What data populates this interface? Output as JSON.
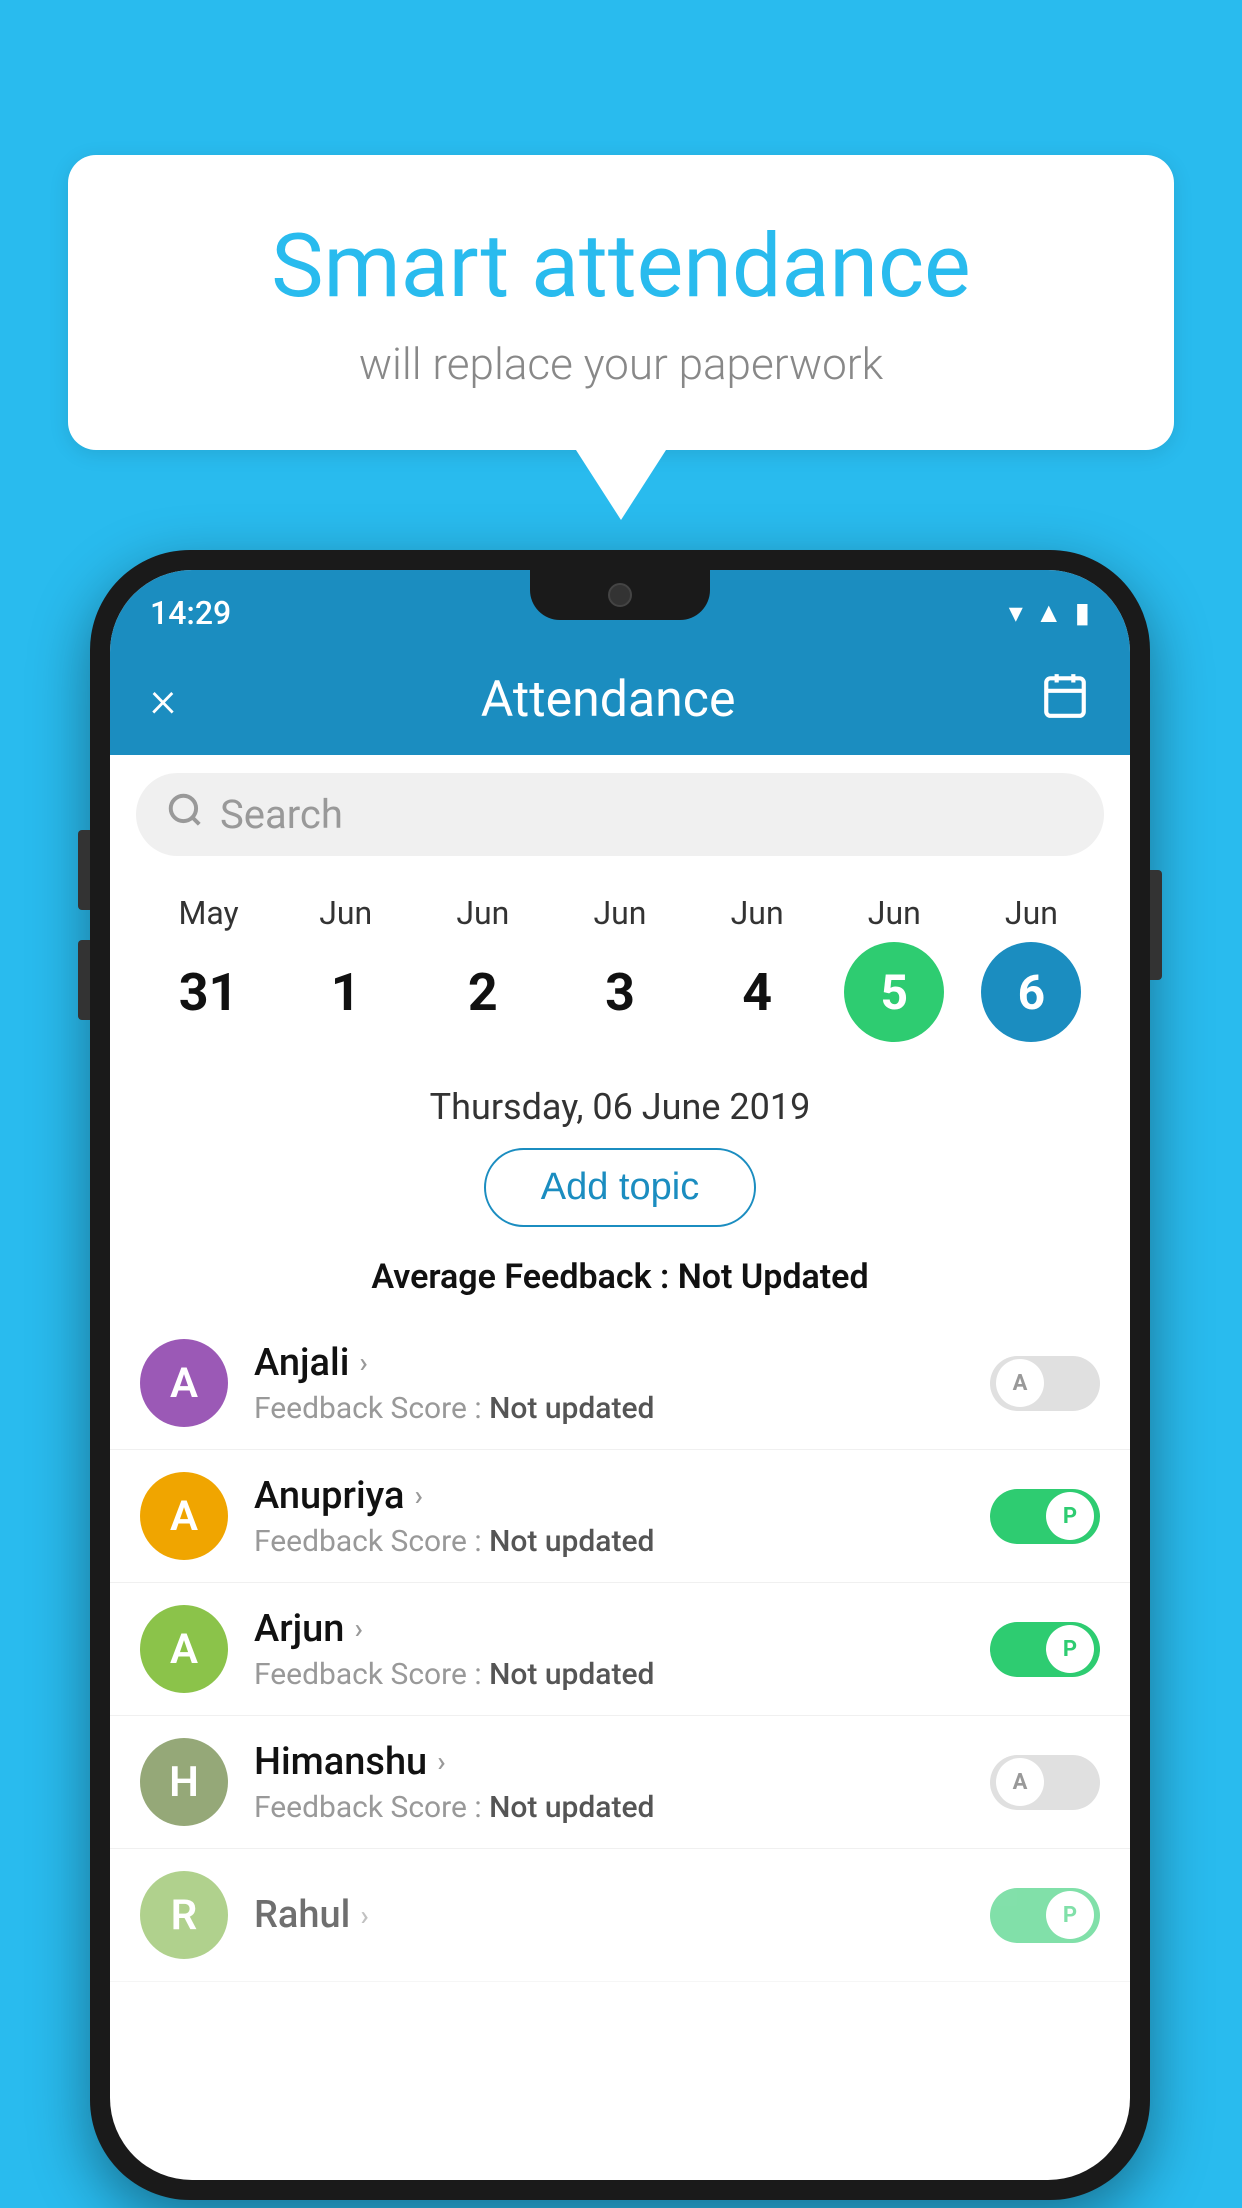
{
  "background_color": "#29BBEE",
  "speech_bubble": {
    "title": "Smart attendance",
    "subtitle": "will replace your paperwork"
  },
  "status_bar": {
    "time": "14:29",
    "icons": [
      "wifi",
      "signal",
      "battery"
    ]
  },
  "header": {
    "title": "Attendance",
    "close_label": "×",
    "calendar_icon": "📅"
  },
  "search": {
    "placeholder": "Search"
  },
  "calendar": {
    "months": [
      "May",
      "Jun",
      "Jun",
      "Jun",
      "Jun",
      "Jun",
      "Jun"
    ],
    "days": [
      "31",
      "1",
      "2",
      "3",
      "4",
      "5",
      "6"
    ],
    "today_index": 5,
    "selected_index": 6
  },
  "date_display": "Thursday, 06 June 2019",
  "add_topic_label": "Add topic",
  "avg_feedback_label": "Average Feedback : ",
  "avg_feedback_value": "Not Updated",
  "students": [
    {
      "name": "Anjali",
      "avatar_letter": "A",
      "avatar_color": "#9B59B6",
      "feedback_label": "Feedback Score : ",
      "feedback_value": "Not updated",
      "toggle_state": "off",
      "toggle_letter": "A"
    },
    {
      "name": "Anupriya",
      "avatar_letter": "A",
      "avatar_color": "#F0A500",
      "feedback_label": "Feedback Score : ",
      "feedback_value": "Not updated",
      "toggle_state": "on",
      "toggle_letter": "P"
    },
    {
      "name": "Arjun",
      "avatar_letter": "A",
      "avatar_color": "#8BC34A",
      "feedback_label": "Feedback Score : ",
      "feedback_value": "Not updated",
      "toggle_state": "on",
      "toggle_letter": "P"
    },
    {
      "name": "Himanshu",
      "avatar_letter": "H",
      "avatar_color": "#95A878",
      "feedback_label": "Feedback Score : ",
      "feedback_value": "Not updated",
      "toggle_state": "off",
      "toggle_letter": "A"
    }
  ]
}
